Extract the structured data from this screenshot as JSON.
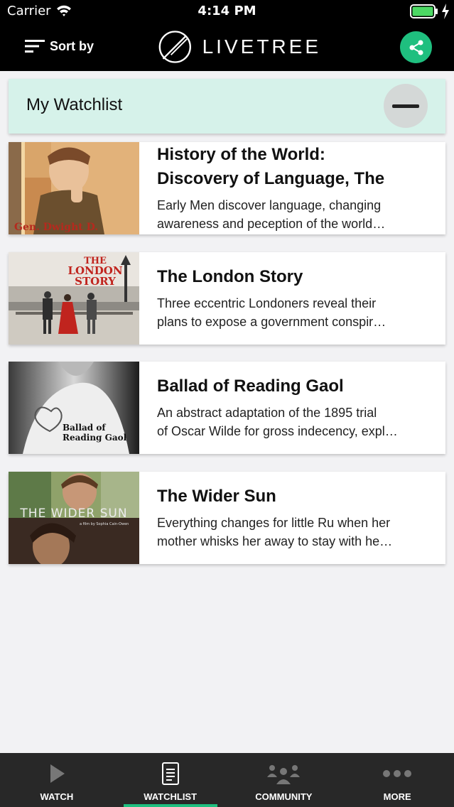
{
  "status_bar": {
    "carrier": "Carrier",
    "time": "4:14 PM"
  },
  "header": {
    "sort_label": "Sort by",
    "logo_text": "LIVETREE"
  },
  "watchlist": {
    "title": "My Watchlist"
  },
  "items": [
    {
      "title_line1": "History of the World:",
      "title_line2": "Discovery of Language, The",
      "desc_line1": "Early Men discover language, changing",
      "desc_line2": "awareness and peception of the world…",
      "thumb_text": "Gen. Dwight D."
    },
    {
      "title_line1": "The London Story",
      "desc_line1": "Three eccentric Londoners reveal their",
      "desc_line2": "plans to expose a government conspir…",
      "thumb_text_1": "THE",
      "thumb_text_2": "LONDON",
      "thumb_text_3": "STORY"
    },
    {
      "title_line1": "Ballad of Reading Gaol",
      "desc_line1": "An abstract adaptation of the 1895 trial",
      "desc_line2": "of Oscar Wilde for gross indecency, expl…",
      "thumb_text_1": "Ballad of",
      "thumb_text_2": "Reading Gaol"
    },
    {
      "title_line1": "The Wider Sun",
      "desc_line1": "Everything changes for little Ru when her",
      "desc_line2": "mother whisks her away to stay with he…",
      "thumb_text_1": "THE WIDER SUN",
      "thumb_text_2": "a film by Sophia Cain-Owen"
    }
  ],
  "tabs": [
    {
      "label": "WATCH",
      "icon": "play-icon"
    },
    {
      "label": "WATCHLIST",
      "icon": "document-icon",
      "active": true
    },
    {
      "label": "COMMUNITY",
      "icon": "people-icon"
    },
    {
      "label": "MORE",
      "icon": "ellipsis-icon"
    }
  ],
  "colors": {
    "accent": "#1fbf7f",
    "watchlist_bg": "#d6f2ea",
    "tab_bar": "#282828"
  }
}
